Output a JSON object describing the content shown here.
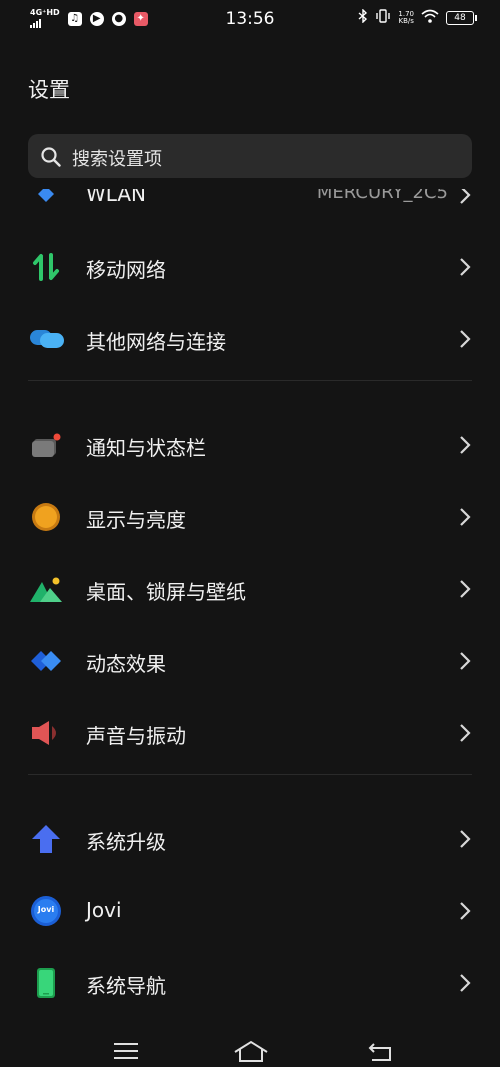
{
  "status_bar": {
    "network": "4G⁺HD",
    "time": "13:56",
    "speed_value": "1.70",
    "speed_unit": "KB/s",
    "battery": "48",
    "notif_icons": [
      "music-icon",
      "play-icon",
      "chat-icon",
      "game-icon"
    ]
  },
  "header": {
    "title": "设置"
  },
  "search": {
    "placeholder": "搜索设置项"
  },
  "items": [
    {
      "label": "WLAN",
      "value": "MERCURY_2C5",
      "icon": "wifi-icon"
    },
    {
      "label": "移动网络",
      "icon": "mobile-network-icon"
    },
    {
      "label": "其他网络与连接",
      "icon": "connections-icon"
    },
    {
      "label": "通知与状态栏",
      "icon": "notification-icon"
    },
    {
      "label": "显示与亮度",
      "icon": "brightness-icon"
    },
    {
      "label": "桌面、锁屏与壁纸",
      "icon": "wallpaper-icon"
    },
    {
      "label": "动态效果",
      "icon": "motion-effects-icon"
    },
    {
      "label": "声音与振动",
      "icon": "sound-icon"
    },
    {
      "label": "系统升级",
      "icon": "system-update-icon"
    },
    {
      "label": "Jovi",
      "icon": "jovi-icon",
      "badge": "Jovi"
    },
    {
      "label": "系统导航",
      "icon": "system-navigation-icon"
    }
  ],
  "colors": {
    "background": "#141414",
    "search_bg": "#2b2b2b",
    "mobile_green": "#2fc66a",
    "cloud_blue": "#3aa0f0",
    "orange": "#f0a21f",
    "red_sound": "#e05555",
    "arrow_blue": "#4a6ef0"
  }
}
